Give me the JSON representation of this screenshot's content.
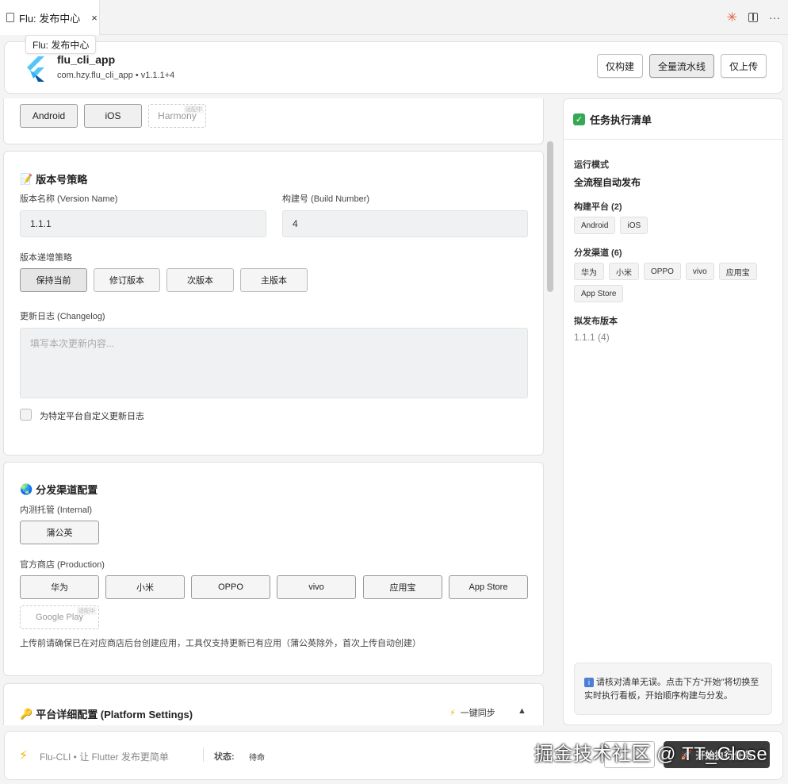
{
  "tab": {
    "title": "Flu: 发布中心",
    "close": "×"
  },
  "tooltip": "Flu: 发布中心",
  "tab_actions": {
    "spark": "✳",
    "more": "···"
  },
  "header": {
    "app_name": "flu_cli_app",
    "app_sub": "com.hzy.flu_cli_app • v1.1.1+4",
    "buttons": [
      "仅构建",
      "全量流水线",
      "仅上传"
    ]
  },
  "platforms": {
    "items": [
      "Android",
      "iOS",
      "Harmony"
    ],
    "adapting_tag": "适配中"
  },
  "version": {
    "title": "版本号策略",
    "name_label": "版本名称 (Version Name)",
    "name_value": "1.1.1",
    "build_label": "构建号 (Build Number)",
    "build_value": "4",
    "strategy_label": "版本递增策略",
    "strategies": [
      "保持当前",
      "修订版本",
      "次版本",
      "主版本"
    ],
    "changelog_label": "更新日志 (Changelog)",
    "changelog_placeholder": "填写本次更新内容...",
    "custom_label": "为特定平台自定义更新日志"
  },
  "channels": {
    "title": "分发渠道配置",
    "internal_label": "内测托管 (Internal)",
    "internal": [
      "蒲公英"
    ],
    "production_label": "官方商店 (Production)",
    "stores": [
      "华为",
      "小米",
      "OPPO",
      "vivo",
      "应用宝",
      "App Store"
    ],
    "google_play": "Google Play",
    "adapting_tag": "适配中",
    "note": "上传前请确保已在对应商店后台创建应用，工具仅支持更新已有应用（蒲公英除外，首次上传自动创建）"
  },
  "platform_settings": {
    "title": "平台详细配置 (Platform Settings)",
    "sync": "一键同步",
    "collapse": "▲"
  },
  "checklist": {
    "title": "任务执行清单",
    "mode_label": "运行模式",
    "mode_value": "全流程自动发布",
    "platforms_label": "构建平台 (2)",
    "platforms": [
      "Android",
      "iOS"
    ],
    "channels_label": "分发渠道 (6)",
    "channels": [
      "华为",
      "小米",
      "OPPO",
      "vivo",
      "应用宝",
      "App Store"
    ],
    "version_label": "拟发布版本",
    "version_value": "1.1.1 (4)",
    "info": "请核对清单无误。点击下方“开始”将切换至实时执行看板，开始顺序构建与分发。"
  },
  "footer": {
    "brand": "Flu-CLI • 让 Flutter 发布更简单",
    "status_label": "状态:",
    "status_value": "待命",
    "start_button": "开始执行任务"
  },
  "watermark": "掘金技术社区 @ TT_Close",
  "colors": {
    "accent_dark": "#3b3b3b",
    "check_green": "#34a853",
    "info_blue": "#4a7fd4",
    "bolt": "#f0b400"
  }
}
